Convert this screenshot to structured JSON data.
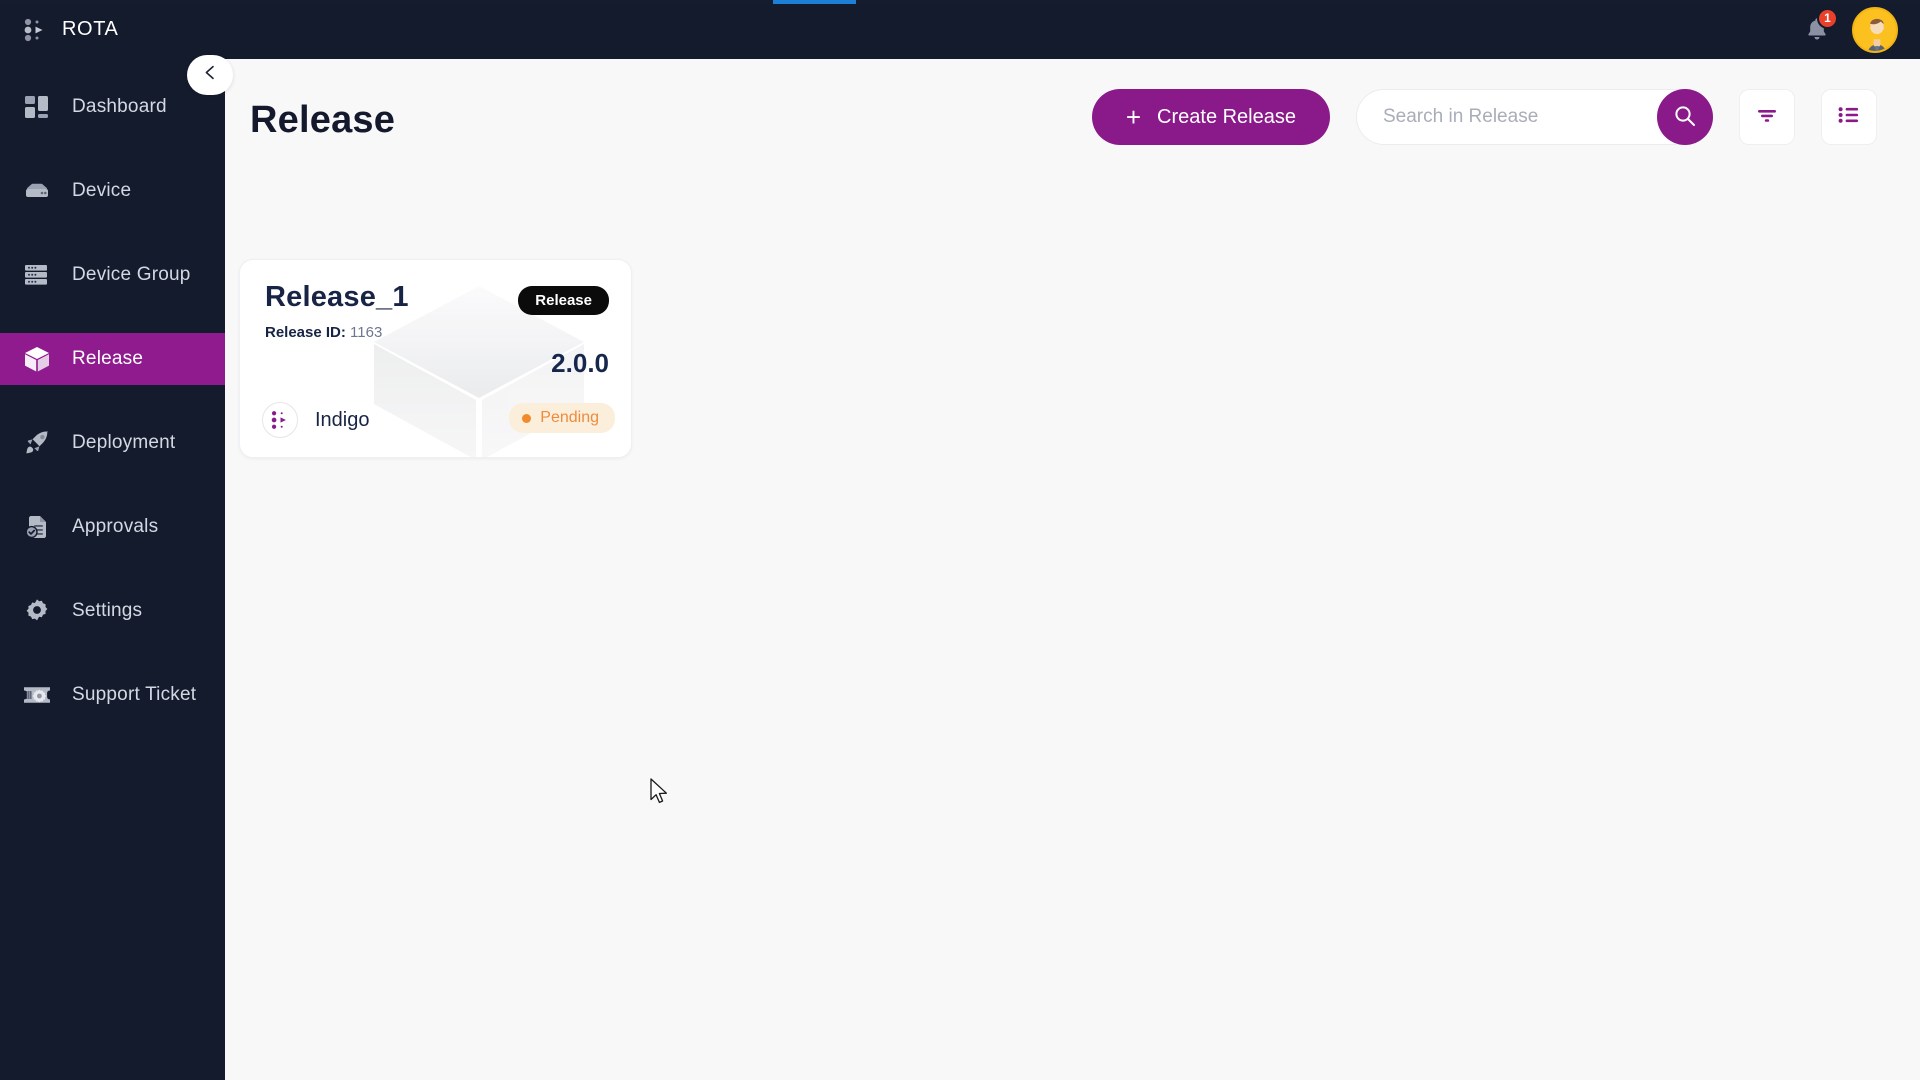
{
  "brand": {
    "name": "ROTA",
    "logo_icon": "rota-dots-logo"
  },
  "topbar": {
    "notification_icon": "bell-icon",
    "notification_count": "1",
    "avatar_icon": "user-avatar"
  },
  "progress": {
    "accent_color": "#1d7fd6",
    "track_color": "#151c2e"
  },
  "sidebar": {
    "collapse_icon": "chevron-left-icon",
    "active_color": "#8f1b8f",
    "items": [
      {
        "label": "Dashboard",
        "icon": "dashboard-icon",
        "active": false
      },
      {
        "label": "Device",
        "icon": "device-icon",
        "active": false
      },
      {
        "label": "Device Group",
        "icon": "device-group-icon",
        "active": false
      },
      {
        "label": "Release",
        "icon": "box-icon",
        "active": true
      },
      {
        "label": "Deployment",
        "icon": "rocket-icon",
        "active": false
      },
      {
        "label": "Approvals",
        "icon": "approvals-icon",
        "active": false
      },
      {
        "label": "Settings",
        "icon": "gear-icon",
        "active": false
      },
      {
        "label": "Support Ticket",
        "icon": "ticket-gear-icon",
        "active": false
      }
    ]
  },
  "page": {
    "title": "Release"
  },
  "toolbar": {
    "create_label": "Create Release",
    "create_icon": "plus-icon",
    "accent_color": "#8a1a8a",
    "search_placeholder": "Search in Release",
    "search_value": "",
    "search_icon": "search-icon",
    "filter_icon": "filter-icon",
    "list_view_icon": "list-view-icon"
  },
  "releases": [
    {
      "name": "Release_1",
      "id_label": "Release ID:",
      "id_value": "1163",
      "type_badge": "Release",
      "version": "2.0.0",
      "owner": "Indigo",
      "owner_icon": "rota-dots-logo",
      "status": "Pending",
      "status_color": "#ef8b3c",
      "status_bg": "#fbeeda"
    }
  ]
}
